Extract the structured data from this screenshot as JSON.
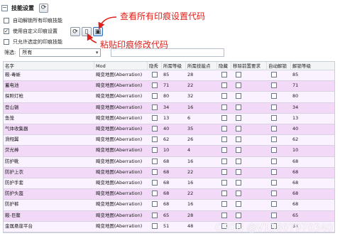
{
  "header": {
    "collapse_symbol": "−",
    "title": "技能设置",
    "refresh_icon": "refresh-icon"
  },
  "options": {
    "auto_unlock_label": "自动解锁所有印痕技能",
    "use_custom_label": "使用自定义印痕设置",
    "use_custom_checked": true,
    "only_selected_label": "只允许选定的印痕技能"
  },
  "toolbar": {
    "reload_icon": "refresh-icon",
    "paste_icon": "document-icon",
    "save_icon": "save-icon"
  },
  "filter": {
    "label": "筛选:",
    "selected": "所有"
  },
  "annotations": {
    "view_all": "查看所有印痕设置代码",
    "paste": "粘贴印痕修改代码",
    "color": "#e0201a"
  },
  "table": {
    "columns": [
      "名字",
      "Mod",
      "隐秀",
      "所需等级",
      "所需技能点",
      "隐藏",
      "移除前置要求",
      "自动解锁",
      "解锁等级"
    ],
    "rows": [
      {
        "name": "鞍-毒蜥",
        "mod": "畸变地图(Aberration)",
        "level": "85",
        "points": "28",
        "unlock": "85"
      },
      {
        "name": "蓄电池",
        "mod": "畸变地图(Aberration)",
        "level": "71",
        "points": "22",
        "unlock": "71"
      },
      {
        "name": "探照灯枪",
        "mod": "畸变地图(Aberration)",
        "level": "80",
        "points": "32",
        "unlock": "80"
      },
      {
        "name": "登山镐",
        "mod": "畸变地图(Aberration)",
        "level": "34",
        "points": "16",
        "unlock": "34"
      },
      {
        "name": "鱼笼",
        "mod": "畸变地图(Aberration)",
        "level": "13",
        "points": "6",
        "unlock": "13"
      },
      {
        "name": "气体收集器",
        "mod": "畸变地图(Aberration)",
        "level": "40",
        "points": "35",
        "unlock": "40"
      },
      {
        "name": "滑翔翼",
        "mod": "畸变地图(Aberration)",
        "level": "62",
        "points": "26",
        "unlock": "62"
      },
      {
        "name": "荧光棒",
        "mod": "畸变地图(Aberration)",
        "level": "10",
        "points": "4",
        "unlock": "10"
      },
      {
        "name": "防护靴",
        "mod": "畸变地图(Aberration)",
        "level": "68",
        "points": "16",
        "unlock": "68"
      },
      {
        "name": "防护上衣",
        "mod": "畸变地图(Aberration)",
        "level": "68",
        "points": "22",
        "unlock": "68"
      },
      {
        "name": "防护手套",
        "mod": "畸变地图(Aberration)",
        "level": "68",
        "points": "16",
        "unlock": "68"
      },
      {
        "name": "防护头盔",
        "mod": "畸变地图(Aberration)",
        "level": "68",
        "points": "22",
        "unlock": "68"
      },
      {
        "name": "防护裤",
        "mod": "畸变地图(Aberration)",
        "level": "68",
        "points": "16",
        "unlock": "68"
      },
      {
        "name": "鞍-巨鳖",
        "mod": "畸变地图(Aberration)",
        "level": "65",
        "points": "28",
        "unlock": "65"
      },
      {
        "name": "金属悬崖平台",
        "mod": "畸变地图(Aberration)",
        "level": "51",
        "points": "48",
        "unlock": "51"
      }
    ]
  },
  "watermark": "CSDN @V13807970340"
}
